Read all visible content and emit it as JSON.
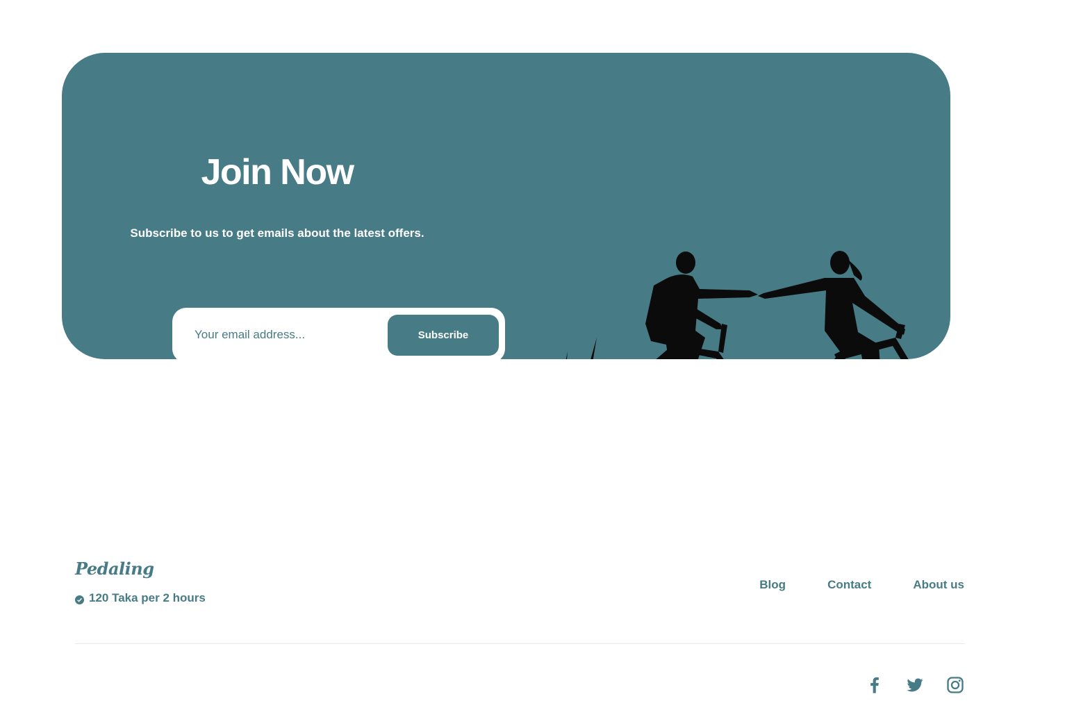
{
  "banner": {
    "title": "Join Now",
    "subtitle": "Subscribe to us to get emails about the latest offers.",
    "email_placeholder": "Your email address...",
    "subscribe_label": "Subscribe",
    "image_icon": "cyclists-silhouette"
  },
  "footer": {
    "logo": "Pedaling",
    "price_text": "120 Taka per 2 hours",
    "price_icon": "check-circle-icon",
    "nav": [
      "Blog",
      "Contact",
      "About us"
    ],
    "social": [
      "facebook-icon",
      "twitter-icon",
      "instagram-icon"
    ]
  },
  "colors": {
    "accent": "#477b85",
    "background": "#ffffff",
    "silhouette": "#0b0b0b",
    "divider": "#e8ecec"
  }
}
